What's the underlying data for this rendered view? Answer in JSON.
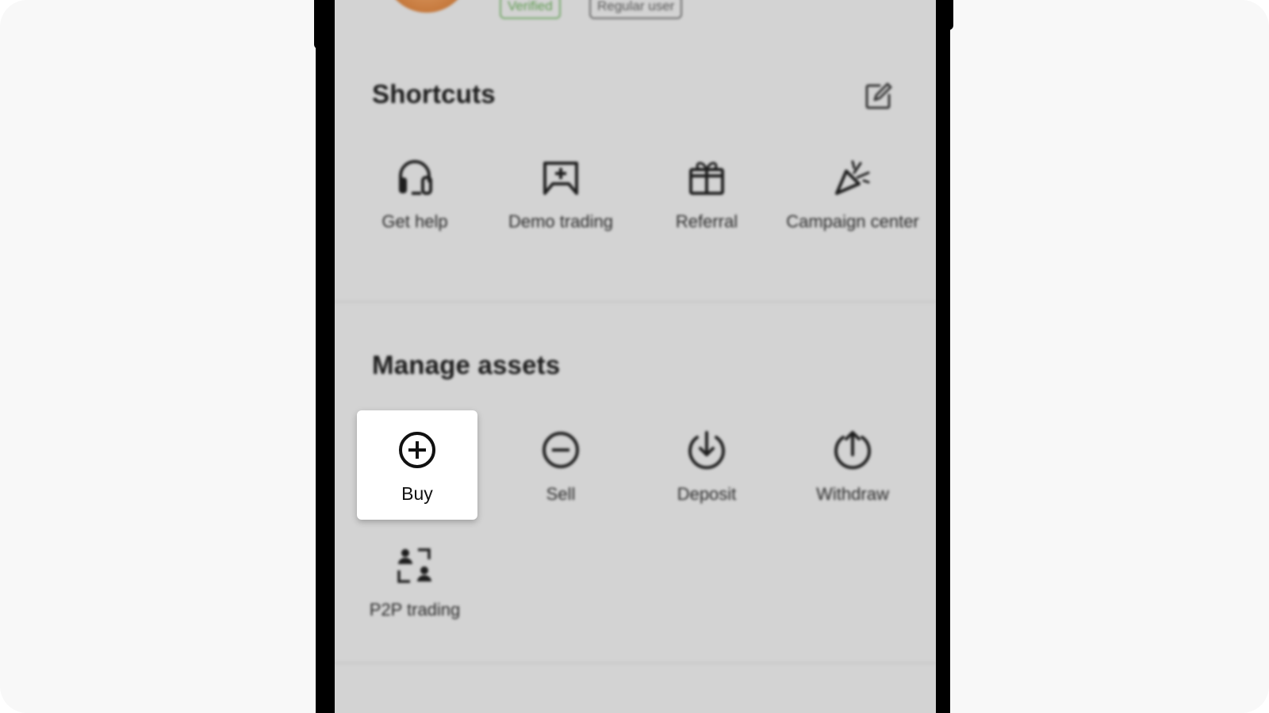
{
  "profile": {
    "badges": [
      "Verified",
      "Regular user"
    ]
  },
  "shortcuts": {
    "title": "Shortcuts",
    "items": [
      {
        "label": "Get help",
        "icon": "headset-icon"
      },
      {
        "label": "Demo trading",
        "icon": "demo-trading-icon"
      },
      {
        "label": "Referral",
        "icon": "gift-icon"
      },
      {
        "label": "Campaign center",
        "icon": "party-popper-icon"
      }
    ],
    "edit_icon": "edit-icon"
  },
  "manage_assets": {
    "title": "Manage assets",
    "items": [
      {
        "label": "Buy",
        "icon": "plus-circle-icon"
      },
      {
        "label": "Sell",
        "icon": "minus-circle-icon"
      },
      {
        "label": "Deposit",
        "icon": "deposit-icon"
      },
      {
        "label": "Withdraw",
        "icon": "withdraw-icon"
      },
      {
        "label": "P2P trading",
        "icon": "p2p-icon"
      }
    ]
  },
  "colors": {
    "screen_bg": "#d3d3d3",
    "verified": "#77a86c",
    "highlight": "#ffffff"
  }
}
